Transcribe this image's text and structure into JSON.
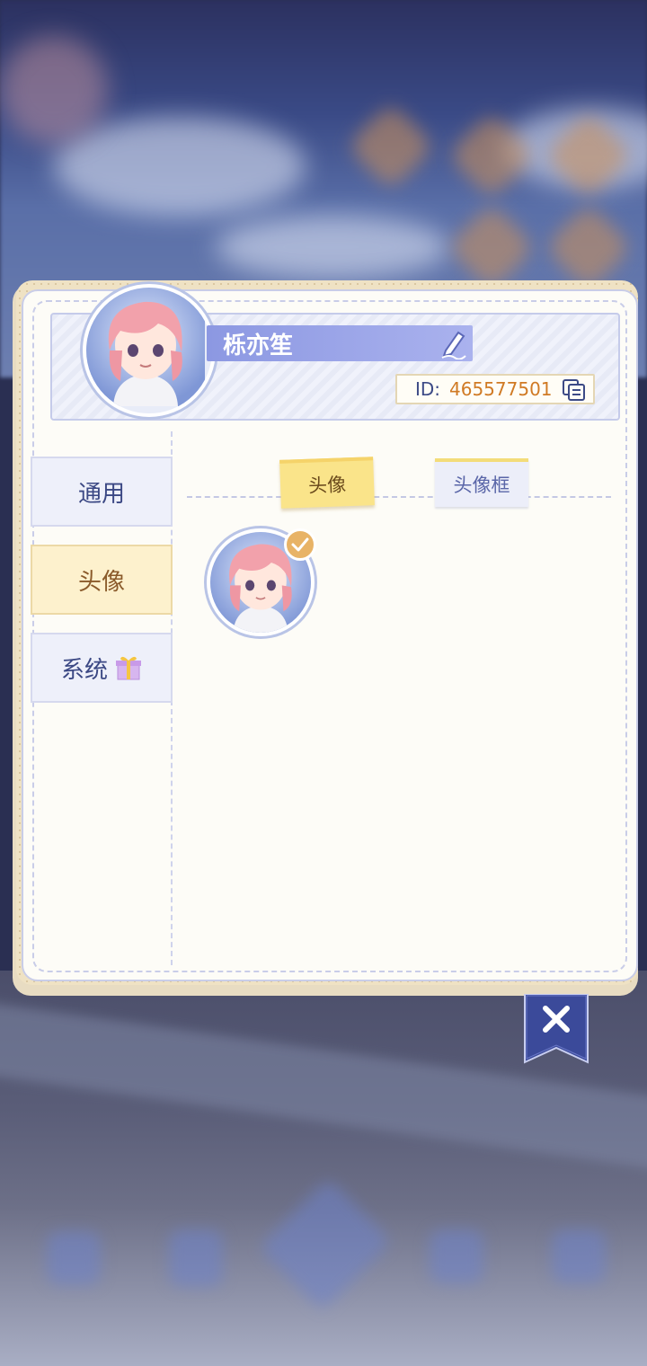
{
  "profile": {
    "name": "栎亦笙",
    "id_label": "ID:",
    "id_value": "465577501"
  },
  "nav": {
    "items": [
      {
        "label": "通用",
        "active": false
      },
      {
        "label": "头像",
        "active": true
      },
      {
        "label": "系统",
        "active": false,
        "icon": "gift-icon"
      }
    ]
  },
  "tabs": [
    {
      "label": "头像",
      "active": true
    },
    {
      "label": "头像框",
      "active": false
    }
  ],
  "avatars": [
    {
      "selected": true
    }
  ],
  "icons": [
    "pen-icon",
    "copy-icon",
    "gift-icon",
    "check-icon",
    "close-icon"
  ],
  "colors": {
    "accent": "#8c98e2",
    "id_value": "#d07a24",
    "active_nav": "#fdf1cd",
    "active_tab": "#fae48a",
    "close_bg": "#3b4a9a"
  }
}
